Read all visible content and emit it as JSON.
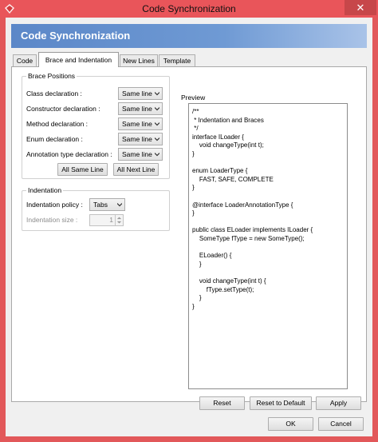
{
  "window": {
    "title": "Code Synchronization",
    "close_glyph": "✕"
  },
  "header": {
    "title": "Code Synchronization"
  },
  "tabs": [
    {
      "label": "Code"
    },
    {
      "label": "Brace and Indentation"
    },
    {
      "label": "New Lines"
    },
    {
      "label": "Template"
    }
  ],
  "brace_positions": {
    "title": "Brace Positions",
    "rows": [
      {
        "label": "Class declaration :",
        "value": "Same line"
      },
      {
        "label": "Constructor declaration :",
        "value": "Same line"
      },
      {
        "label": "Method declaration :",
        "value": "Same line"
      },
      {
        "label": "Enum declaration :",
        "value": "Same line"
      },
      {
        "label": "Annotation type declaration :",
        "value": "Same line"
      }
    ],
    "all_same_line": "All Same Line",
    "all_next_line": "All Next Line"
  },
  "indentation": {
    "title": "Indentation",
    "policy_label": "Indentation policy :",
    "policy_value": "Tabs",
    "size_label": "Indentation size :",
    "size_value": "1"
  },
  "preview": {
    "title": "Preview",
    "lines": [
      "/**",
      " * Indentation and Braces",
      " */",
      "interface ILoader {",
      "    void changeType(int t);",
      "}",
      "",
      "enum LoaderType {",
      "    FAST, SAFE, COMPLETE",
      "}",
      "",
      "@interface LoaderAnnotationType {",
      "}",
      "",
      "public class ELoader implements ILoader {",
      "    SomeType fType = new SomeType();",
      "",
      "    ELoader() {",
      "    }",
      "",
      "    void changeType(int t) {",
      "        fType.setType(t);",
      "    }",
      "}"
    ]
  },
  "buttons": {
    "reset": "Reset",
    "reset_default": "Reset to Default",
    "apply": "Apply",
    "ok": "OK",
    "cancel": "Cancel"
  },
  "colors": {
    "accent": "#e9555a",
    "banner": "#5b87c8"
  }
}
